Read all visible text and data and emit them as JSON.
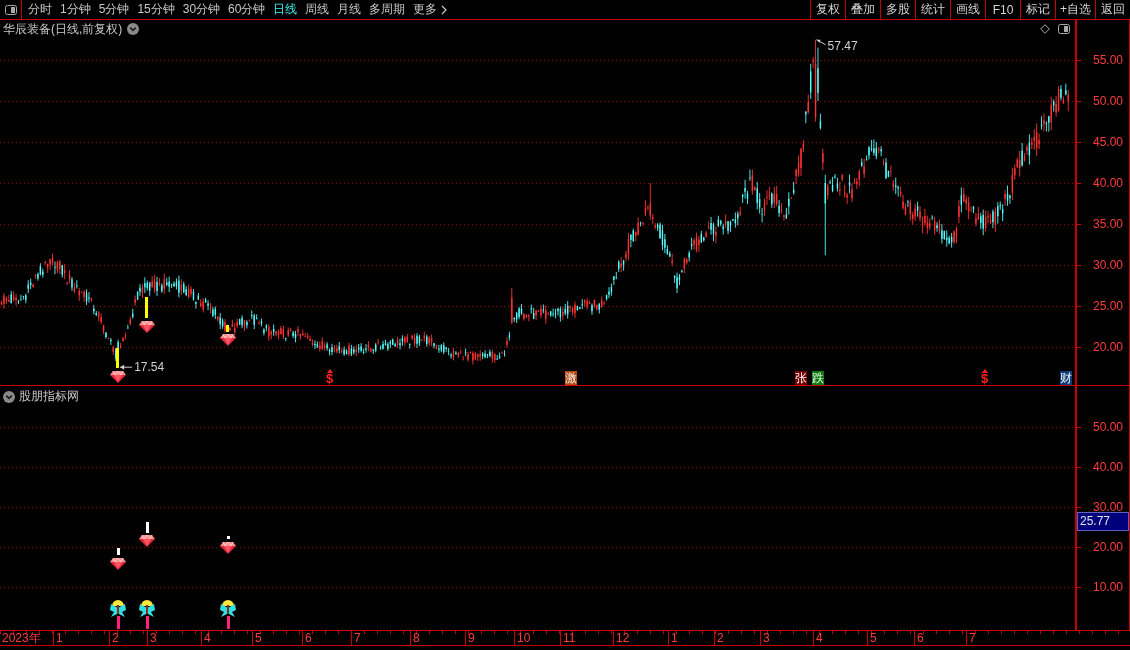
{
  "toolbar": {
    "periods": [
      {
        "label": "分时",
        "selected": false
      },
      {
        "label": "1分钟",
        "selected": false
      },
      {
        "label": "5分钟",
        "selected": false
      },
      {
        "label": "15分钟",
        "selected": false
      },
      {
        "label": "30分钟",
        "selected": false
      },
      {
        "label": "60分钟",
        "selected": false
      },
      {
        "label": "日线",
        "selected": true
      },
      {
        "label": "周线",
        "selected": false
      },
      {
        "label": "月线",
        "selected": false
      },
      {
        "label": "多周期",
        "selected": false
      }
    ],
    "more": "更多",
    "actions": [
      "复权",
      "叠加",
      "多股",
      "统计",
      "画线",
      "F10",
      "标记",
      "+自选",
      "返回"
    ]
  },
  "main_chart": {
    "title": "华辰装备(日线,前复权)",
    "price_labels": [
      "55.00",
      "50.00",
      "45.00",
      "40.00",
      "35.00",
      "30.00",
      "25.00",
      "20.00"
    ],
    "high_label": "57.47",
    "low_label": "17.54",
    "events": [
      {
        "kind": "dollar",
        "text": "$"
      },
      {
        "kind": "tag",
        "text": "激",
        "color": "#b84a10"
      },
      {
        "kind": "tag",
        "text": "张",
        "color": "#7a0000"
      },
      {
        "kind": "tag",
        "text": "跌",
        "color": "#0a7a0a"
      },
      {
        "kind": "dollar",
        "text": "$"
      },
      {
        "kind": "tag",
        "text": "财",
        "color": "#0c3c78"
      }
    ]
  },
  "indicator": {
    "title": "股朋指标网",
    "axis_labels": [
      "50.00",
      "40.00",
      "30.00",
      "20.00",
      "10.00"
    ],
    "current_value": "25.77"
  },
  "time_axis": {
    "labels": [
      "2023年",
      "1",
      "2",
      "3",
      "4",
      "5",
      "6",
      "7",
      "8",
      "9",
      "10",
      "11",
      "12",
      "1",
      "2",
      "3",
      "4",
      "5",
      "6",
      "7"
    ]
  }
}
